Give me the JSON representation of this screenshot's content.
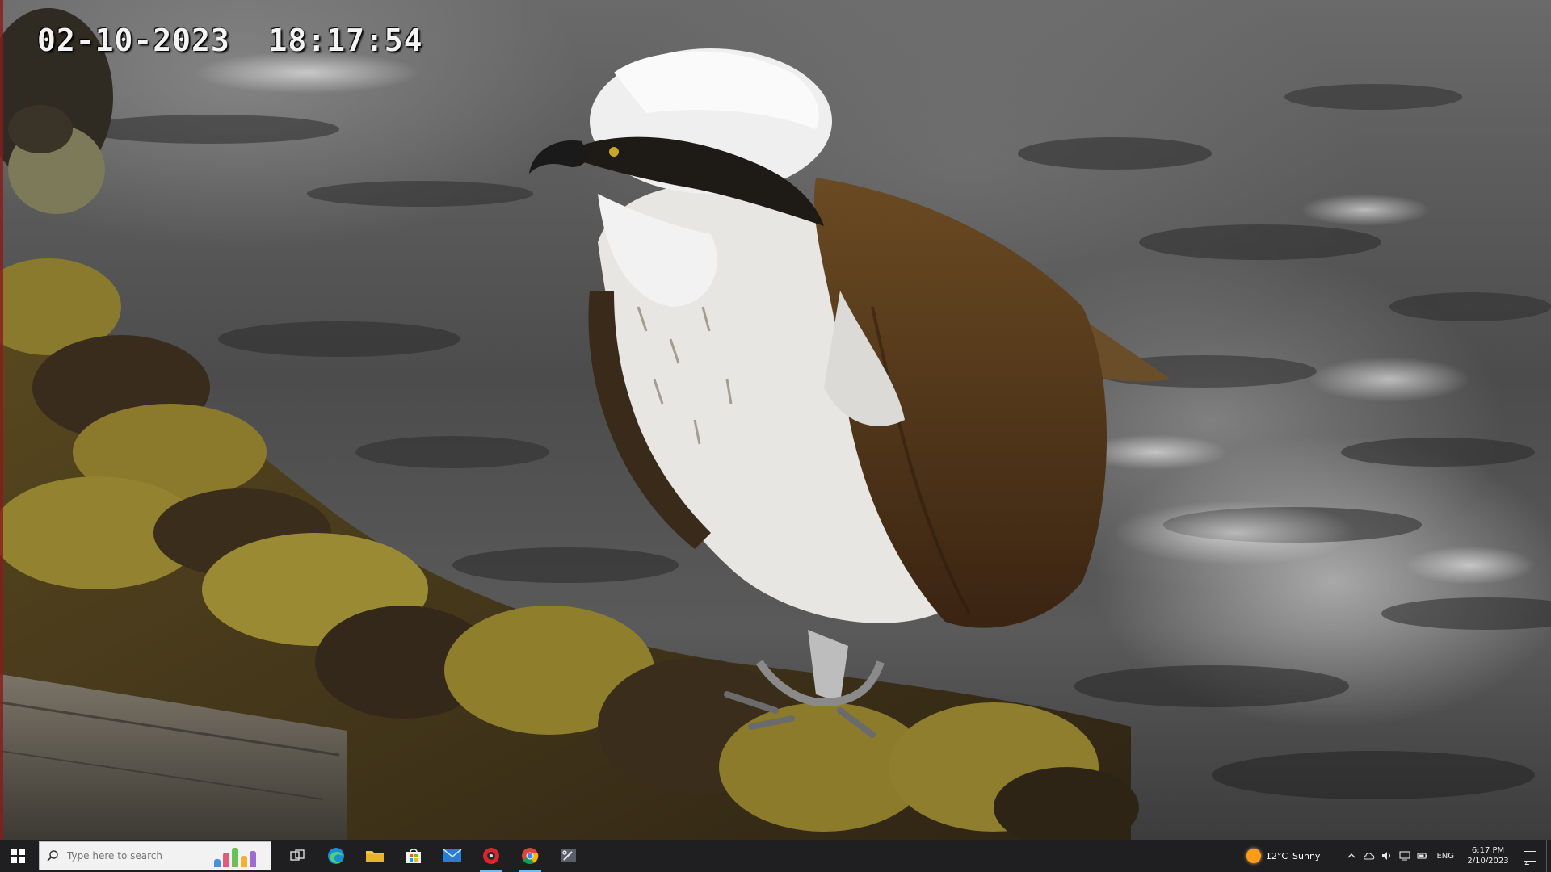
{
  "feed": {
    "timestamp": "02-10-2023  18:17:54",
    "subject": "osprey-on-rope-perch"
  },
  "taskbar": {
    "start_icon": "windows-logo-icon",
    "search": {
      "placeholder": "Type here to search"
    },
    "apps": [
      {
        "name": "task-view",
        "icon": "task-view-icon",
        "active": false
      },
      {
        "name": "edge",
        "icon": "edge-icon",
        "active": false
      },
      {
        "name": "file-explorer",
        "icon": "folder-icon",
        "active": false
      },
      {
        "name": "microsoft-store",
        "icon": "store-icon",
        "active": false
      },
      {
        "name": "mail",
        "icon": "mail-icon",
        "active": false
      },
      {
        "name": "app-red",
        "icon": "red-circle-app-icon",
        "active": true
      },
      {
        "name": "chrome",
        "icon": "chrome-icon",
        "active": true
      },
      {
        "name": "snipping-tool",
        "icon": "snipping-tool-icon",
        "active": false
      }
    ],
    "weather": {
      "temperature": "12°C",
      "condition": "Sunny"
    },
    "language": "ENG",
    "clock": {
      "time": "6:17 PM",
      "date": "2/10/2023"
    }
  }
}
